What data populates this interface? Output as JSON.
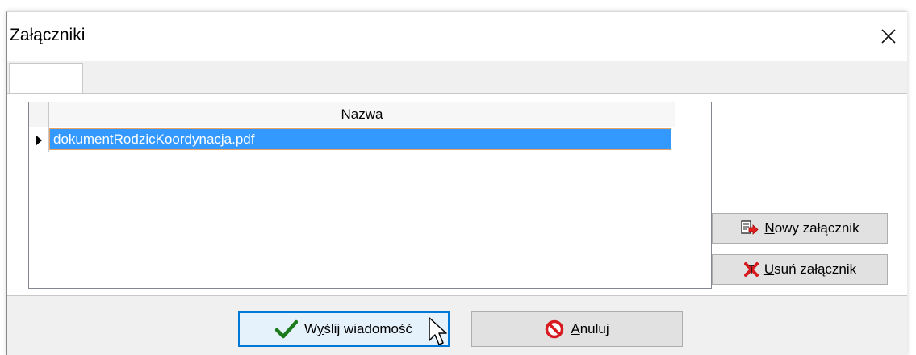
{
  "window": {
    "title": "Załączniki",
    "close_symbol": "✕"
  },
  "tabs": [
    {
      "label": ""
    }
  ],
  "grid": {
    "columns": [
      "Nazwa"
    ],
    "rows": [
      {
        "name": "dokumentRodzicKoordynacja.pdf",
        "selected": true
      }
    ]
  },
  "buttons": {
    "new_attachment": {
      "hotkey": "N",
      "rest": "owy załącznik",
      "icon": "add-document-icon"
    },
    "delete_attachment": {
      "hotkey": "U",
      "rest": "suń załącznik",
      "icon": "delete-x-icon"
    },
    "send": {
      "prefix": "W",
      "hotkey": "y",
      "rest": "ślij wiadomość",
      "icon": "checkmark-icon"
    },
    "cancel": {
      "hotkey": "A",
      "rest": "nuluj",
      "icon": "prohibited-icon"
    }
  },
  "colors": {
    "selection": "#3399ff",
    "selection_border": "#e8a160",
    "default_button_border": "#0078d7",
    "check_green": "#1b7a1b",
    "cancel_red": "#d71920"
  }
}
